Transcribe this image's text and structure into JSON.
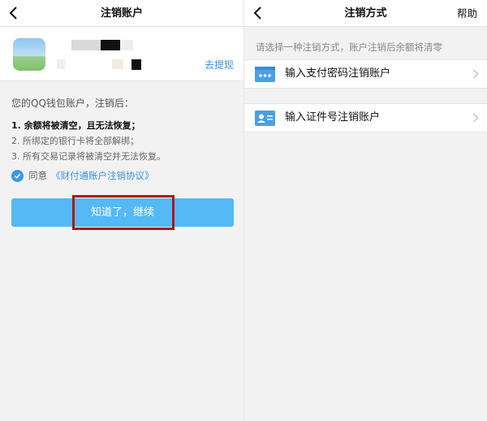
{
  "left": {
    "nav": {
      "title": "注销账户"
    },
    "account": {
      "withdraw_link": "去提现"
    },
    "notice": {
      "heading": "您的QQ钱包账户，注销后：",
      "items": [
        "1. 余额将被清空，且无法恢复；",
        "2. 所绑定的银行卡将全部解绑；",
        "3. 所有交易记录将被清空并无法恢复。"
      ]
    },
    "agreement": {
      "prefix": "同意",
      "link": "《财付通账户注销协议》"
    },
    "continue_button": "知道了，继续"
  },
  "right": {
    "nav": {
      "title": "注销方式",
      "help": "帮助"
    },
    "prompt": "请选择一种注销方式，账户注销后余额将清零",
    "options": [
      {
        "label": "输入支付密码注销账户",
        "icon": "password-card-icon"
      },
      {
        "label": "输入证件号注销账户",
        "icon": "id-card-icon"
      }
    ]
  },
  "colors": {
    "accent": "#3a97e8",
    "button": "#55b9f5",
    "link": "#3a8fe0",
    "highlight": "#b0131a",
    "background": "#f2f2f2"
  }
}
